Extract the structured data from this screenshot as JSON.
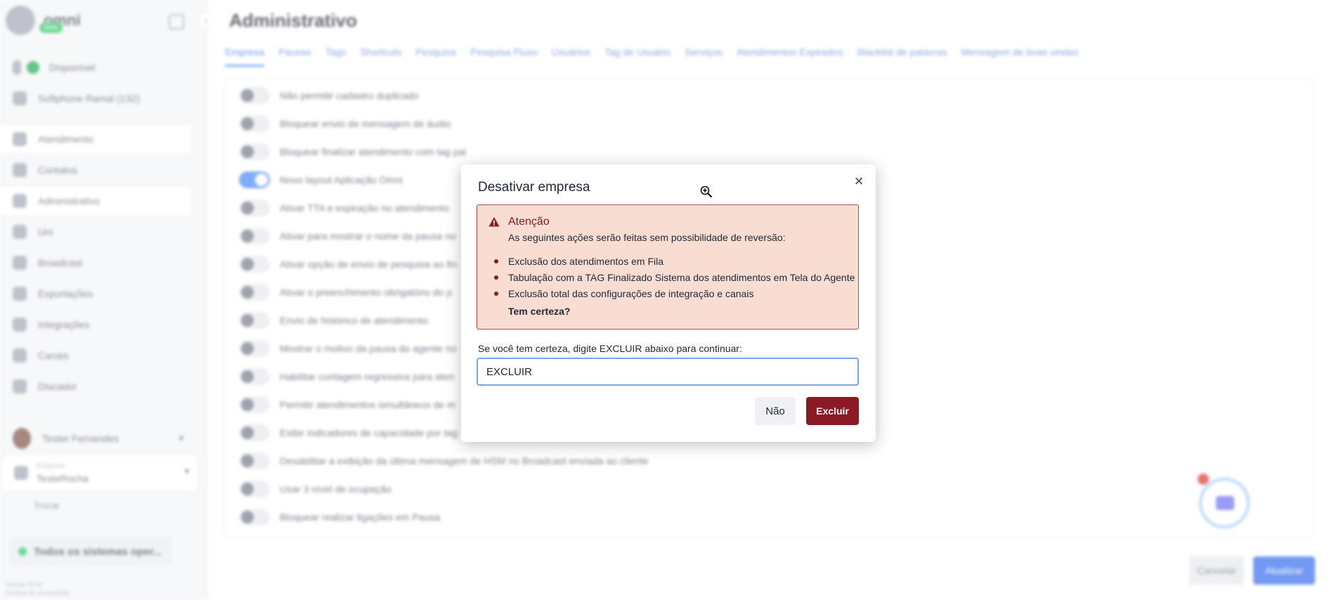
{
  "sidebar": {
    "brand_name": "omni",
    "brand_badge": "beta",
    "status": "Disponível",
    "softphone": "Softphone Ramal (132)",
    "items": [
      {
        "label": "Atendimento"
      },
      {
        "label": "Contatos"
      },
      {
        "label": "Administrativo"
      },
      {
        "label": "Uni"
      },
      {
        "label": "Broadcast"
      },
      {
        "label": "Exportações"
      },
      {
        "label": "Integrações"
      },
      {
        "label": "Canais"
      },
      {
        "label": "Discador"
      }
    ],
    "user_name": "Tester Fernandes",
    "company_small": "Empresa",
    "company_name": "TesteRocha",
    "foot_link": "Trocar",
    "system_status": "Todos os sistemas oper...",
    "version_line1": "Versão 00.00",
    "version_line2": "Política de privacidade"
  },
  "main": {
    "title": "Administrativo",
    "tabs": [
      {
        "label": "Empresa"
      },
      {
        "label": "Pausas"
      },
      {
        "label": "Tags"
      },
      {
        "label": "Shortcuts"
      },
      {
        "label": "Pesquisa"
      },
      {
        "label": "Pesquisa Fluxo"
      },
      {
        "label": "Usuários"
      },
      {
        "label": "Tag de Usuário"
      },
      {
        "label": "Serviços"
      },
      {
        "label": "Atendimentos Expirados"
      },
      {
        "label": "Blacklist de palavras"
      },
      {
        "label": "Mensagem de boas vindas"
      }
    ],
    "settings": [
      {
        "label": "Não permitir cadastro duplicado",
        "on": false
      },
      {
        "label": "Bloquear envio de mensagem de áudio",
        "on": false
      },
      {
        "label": "Bloquear finalizar atendimento com tag pai",
        "on": false
      },
      {
        "label": "Novo layout Aplicação Omni",
        "on": true
      },
      {
        "label": "Ativar TTA e expiração no atendimento",
        "on": false
      },
      {
        "label": "Ativar para mostrar o nome da pausa no",
        "on": false
      },
      {
        "label": "Ativar opção de envio de pesquisa ao fin",
        "on": false
      },
      {
        "label": "Ativar o preenchimento obrigatório do p",
        "on": false
      },
      {
        "label": "Envio de histórico de atendimento",
        "on": false
      },
      {
        "label": "Mostrar o motivo da pausa do agente no",
        "on": false
      },
      {
        "label": "Habilitar contagem regressiva para aten",
        "on": false
      },
      {
        "label": "Permitir atendimentos simultâneos de m",
        "on": false
      },
      {
        "label": "Exibir indicadores de capacidade por tag",
        "on": false
      },
      {
        "label": "Desabilitar a exibição da última mensagem de HSM no Broadcast enviada ao cliente",
        "on": false
      },
      {
        "label": "Usar 3 nível de ocupação",
        "on": false
      },
      {
        "label": "Bloquear realizar ligações em Pausa",
        "on": false
      }
    ],
    "cancel_label": "Cancelar",
    "save_label": "Atualizar"
  },
  "modal": {
    "title": "Desativar empresa",
    "close_icon": "close-icon",
    "alert": {
      "heading": "Atenção",
      "description": "As seguintes ações serão feitas sem possibilidade de reversão:",
      "items": [
        "Exclusão dos atendimentos em Fila",
        "Tabulação com a TAG Finalizado Sistema dos atendimentos em Tela do Agente",
        "Exclusão total das configurações de integração e canais"
      ],
      "confirm": "Tem certeza?",
      "color_bg": "#f9dcd2",
      "color_border": "#b84b4b"
    },
    "prompt": "Se você tem certeza, digite EXCLUIR abaixo para continuar:",
    "input_value": "EXCLUIR",
    "no_label": "Não",
    "delete_label": "Excluir",
    "delete_color": "#8b1a24"
  }
}
